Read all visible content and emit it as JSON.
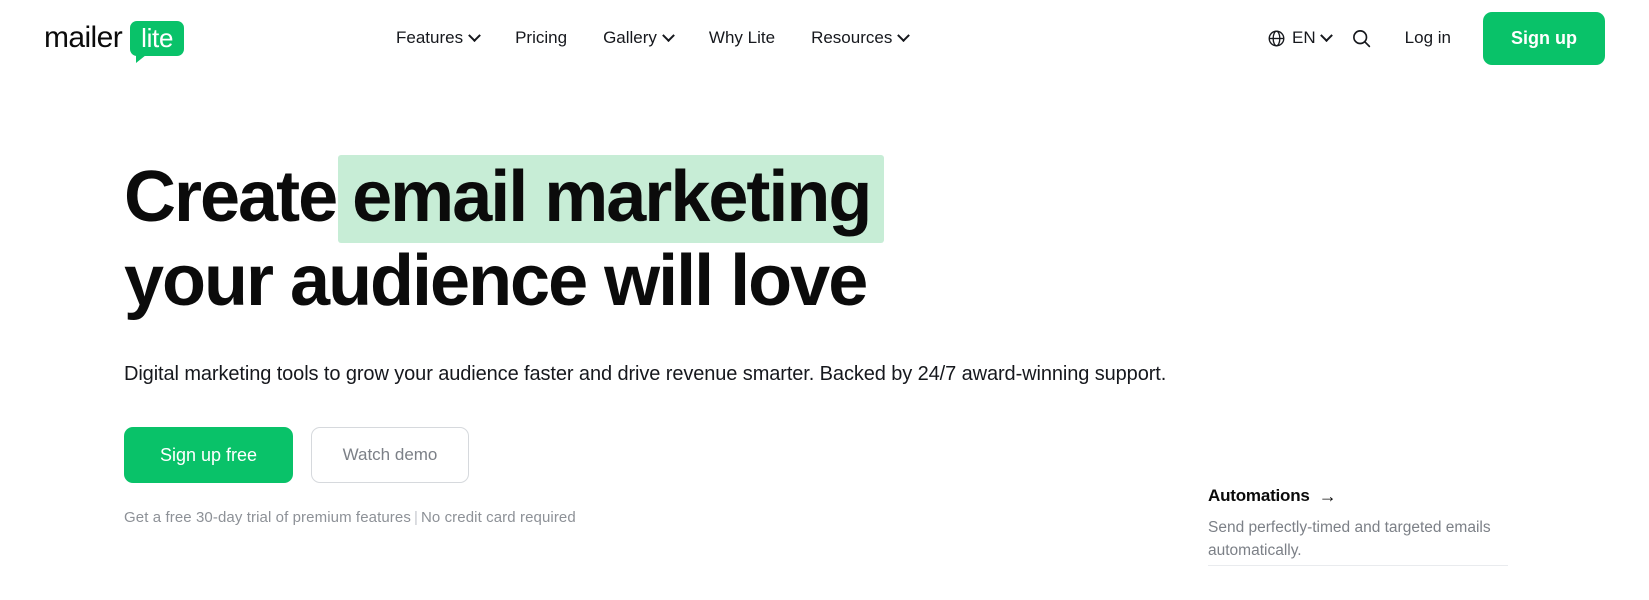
{
  "header": {
    "logo": {
      "word": "mailer",
      "badge": "lite"
    },
    "nav": [
      {
        "label": "Features",
        "has_chevron": true
      },
      {
        "label": "Pricing",
        "has_chevron": false
      },
      {
        "label": "Gallery",
        "has_chevron": true
      },
      {
        "label": "Why Lite",
        "has_chevron": false
      },
      {
        "label": "Resources",
        "has_chevron": true
      }
    ],
    "language": {
      "icon": "globe-icon",
      "label": "EN",
      "has_chevron": true
    },
    "search_icon": "search-icon",
    "login_label": "Log in",
    "signup_label": "Sign up"
  },
  "hero": {
    "headline_line1_plain": "Create",
    "headline_line1_highlight": "email marketing",
    "headline_line2": "your audience will love",
    "subheading": "Digital marketing tools to grow your audience faster and drive revenue smarter. Backed by 24/7 award-winning support.",
    "primary_cta": "Sign up free",
    "secondary_cta": "Watch demo",
    "fineprint_left": "Get a free 30-day trial of premium features",
    "fineprint_separator": "|",
    "fineprint_right": "No credit card required"
  },
  "feature_card": {
    "title": "Automations",
    "arrow": "→",
    "description": "Send perfectly-timed and targeted emails automatically."
  },
  "colors": {
    "brand_green": "#09c269",
    "highlight_green": "#c7edd6",
    "text_dark": "#16181d",
    "text_muted": "#7c8087",
    "border": "#d6d9dd"
  }
}
